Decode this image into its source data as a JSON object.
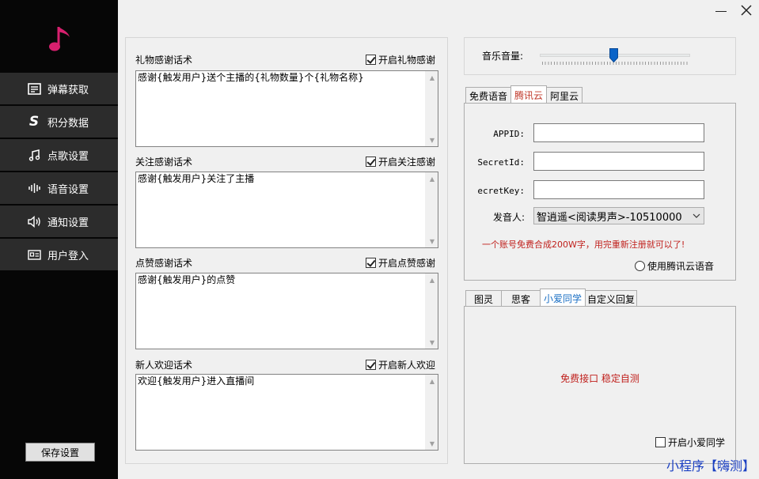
{
  "colors": {
    "sidebar_bg": "#060606",
    "nav_item_bg": "#2c2c2c",
    "logo_pink": "#d7206e",
    "accent_red": "#c0201c",
    "accent_blue": "#1a6fc4",
    "slider_thumb": "#0a64c8"
  },
  "sidebar": {
    "logo_icon": "music-note-icon",
    "items": [
      {
        "label": "弹幕获取",
        "icon": "list-icon"
      },
      {
        "label": "积分数据",
        "icon": "s-logo-icon"
      },
      {
        "label": "点歌设置",
        "icon": "music-note-icon"
      },
      {
        "label": "语音设置",
        "icon": "waveform-icon"
      },
      {
        "label": "通知设置",
        "icon": "speaker-icon"
      },
      {
        "label": "用户登入",
        "icon": "id-card-icon"
      }
    ],
    "save_label": "保存设置"
  },
  "thanks": {
    "gift": {
      "label": "礼物感谢话术",
      "check_label": "开启礼物感谢",
      "checked": true,
      "text": "感谢{触发用户}送个主播的{礼物数量}个{礼物名称}"
    },
    "follow": {
      "label": "关注感谢话术",
      "check_label": "开启关注感谢",
      "checked": true,
      "text": "感谢{触发用户}关注了主播"
    },
    "like": {
      "label": "点赞感谢话术",
      "check_label": "开启点赞感谢",
      "checked": true,
      "text": "感谢{触发用户}的点赞"
    },
    "welcome": {
      "label": "新人欢迎话术",
      "check_label": "开启新人欢迎",
      "checked": true,
      "text": "欢迎{触发用户}进入直播间"
    }
  },
  "volume": {
    "label": "音乐音量:",
    "level_percent": 50
  },
  "tts": {
    "tabs": [
      "免费语音",
      "腾讯云",
      "阿里云"
    ],
    "active_tab": "腾讯云",
    "appid_label": "APPID:",
    "secretid_label": "SecretId:",
    "secretkey_label": "ecretKey:",
    "voice_label": "发音人:",
    "voice_value": "智逍遥<阅读男声>-10510000",
    "note": "一个账号免费合成200W字，用完重新注册就可以了!",
    "radio_label": "使用腾讯云语音"
  },
  "bot": {
    "tabs": [
      "图灵",
      "思客",
      "小爱同学",
      "自定义回复"
    ],
    "active_tab": "小爱同学",
    "note": "免费接口 稳定自测",
    "check_label": "开启小爱同学"
  },
  "watermark": "小程序【嗨测】"
}
